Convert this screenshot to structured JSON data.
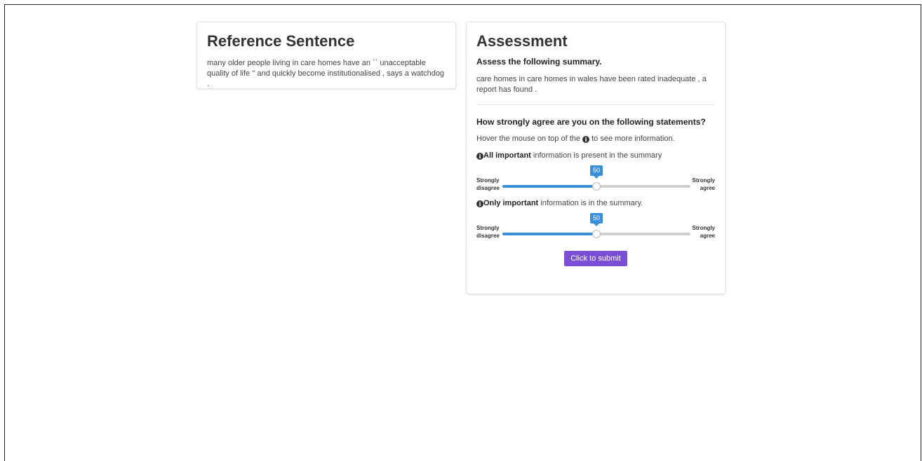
{
  "reference": {
    "title": "Reference Sentence",
    "text": "many older people living in care homes have an `` unacceptable quality of life '' and quickly become institutionalised , says a watchdog ."
  },
  "assessment": {
    "title": "Assessment",
    "instruction": "Assess the following summary.",
    "summary": "care homes in care homes in wales have been rated inadequate , a report has found .",
    "question": "How strongly agree are you on the following statements?",
    "hint_before": "Hover the mouse on top of the ",
    "hint_after": " to see more information.",
    "statements": [
      {
        "bold": "All important",
        "rest": " information is present in the summary",
        "value": "50",
        "fraction": 0.5,
        "left_label": "Strongly disagree",
        "right_label": "Strongly agree"
      },
      {
        "bold": "Only important",
        "rest": " information is in the summary.",
        "value": "50",
        "fraction": 0.5,
        "left_label": "Strongly disagree",
        "right_label": "Strongly agree"
      }
    ],
    "submit_label": "Click to submit"
  },
  "icons": {
    "info": "info-icon"
  },
  "colors": {
    "accent": "#3a8fd8",
    "submit": "#7a4fd6"
  }
}
